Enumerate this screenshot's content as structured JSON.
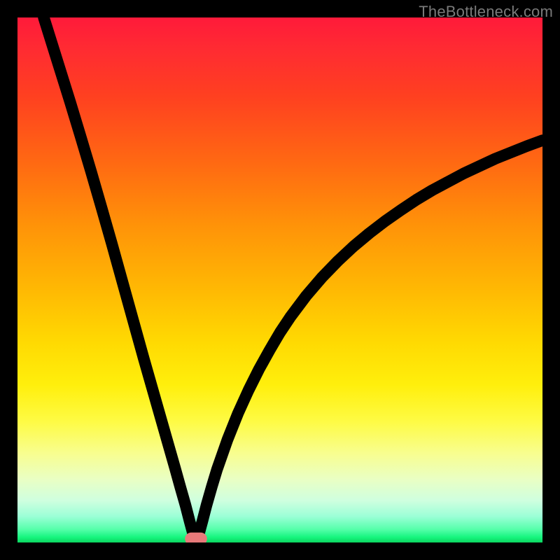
{
  "watermark": "TheBottleneck.com",
  "chart_data": {
    "type": "line",
    "title": "",
    "xlabel": "",
    "ylabel": "",
    "xlim": [
      0,
      100
    ],
    "ylim": [
      0,
      100
    ],
    "grid": false,
    "legend": false,
    "notch_x": 34,
    "marker": {
      "x": 34,
      "y": 0.6,
      "color": "#E77A7A"
    },
    "series": [
      {
        "name": "curve",
        "color": "#000000",
        "points": [
          {
            "x": 5.0,
            "y": 100.0
          },
          {
            "x": 6.0,
            "y": 96.8
          },
          {
            "x": 8.0,
            "y": 90.4
          },
          {
            "x": 10.0,
            "y": 84.0
          },
          {
            "x": 12.0,
            "y": 77.4
          },
          {
            "x": 14.0,
            "y": 70.7
          },
          {
            "x": 16.0,
            "y": 63.8
          },
          {
            "x": 18.0,
            "y": 56.8
          },
          {
            "x": 20.0,
            "y": 49.6
          },
          {
            "x": 22.0,
            "y": 42.4
          },
          {
            "x": 24.0,
            "y": 35.2
          },
          {
            "x": 26.0,
            "y": 28.2
          },
          {
            "x": 28.0,
            "y": 21.2
          },
          {
            "x": 30.0,
            "y": 14.2
          },
          {
            "x": 31.0,
            "y": 10.6
          },
          {
            "x": 32.0,
            "y": 7.1
          },
          {
            "x": 32.8,
            "y": 4.0
          },
          {
            "x": 33.4,
            "y": 1.8
          },
          {
            "x": 33.8,
            "y": 0.7
          },
          {
            "x": 34.0,
            "y": 0.5
          },
          {
            "x": 34.2,
            "y": 0.7
          },
          {
            "x": 34.6,
            "y": 1.8
          },
          {
            "x": 35.2,
            "y": 4.0
          },
          {
            "x": 36.0,
            "y": 7.1
          },
          {
            "x": 37.0,
            "y": 10.6
          },
          {
            "x": 38.0,
            "y": 13.9
          },
          {
            "x": 40.0,
            "y": 19.6
          },
          {
            "x": 42.0,
            "y": 24.6
          },
          {
            "x": 44.0,
            "y": 29.0
          },
          {
            "x": 46.0,
            "y": 33.0
          },
          {
            "x": 48.0,
            "y": 36.6
          },
          {
            "x": 50.0,
            "y": 40.0
          },
          {
            "x": 52.0,
            "y": 43.0
          },
          {
            "x": 55.0,
            "y": 47.0
          },
          {
            "x": 58.0,
            "y": 50.5
          },
          {
            "x": 61.0,
            "y": 53.6
          },
          {
            "x": 64.0,
            "y": 56.4
          },
          {
            "x": 67.0,
            "y": 58.9
          },
          {
            "x": 70.0,
            "y": 61.2
          },
          {
            "x": 73.0,
            "y": 63.3
          },
          {
            "x": 76.0,
            "y": 65.3
          },
          {
            "x": 79.0,
            "y": 67.1
          },
          {
            "x": 82.0,
            "y": 68.7
          },
          {
            "x": 85.0,
            "y": 70.3
          },
          {
            "x": 88.0,
            "y": 71.7
          },
          {
            "x": 91.0,
            "y": 73.1
          },
          {
            "x": 94.0,
            "y": 74.3
          },
          {
            "x": 97.0,
            "y": 75.5
          },
          {
            "x": 100.0,
            "y": 76.6
          }
        ]
      }
    ],
    "background_gradient": {
      "type": "vertical",
      "top": "#FF1A3A",
      "middle": "#FFEF0C",
      "bottom": "#0CD65F"
    }
  }
}
